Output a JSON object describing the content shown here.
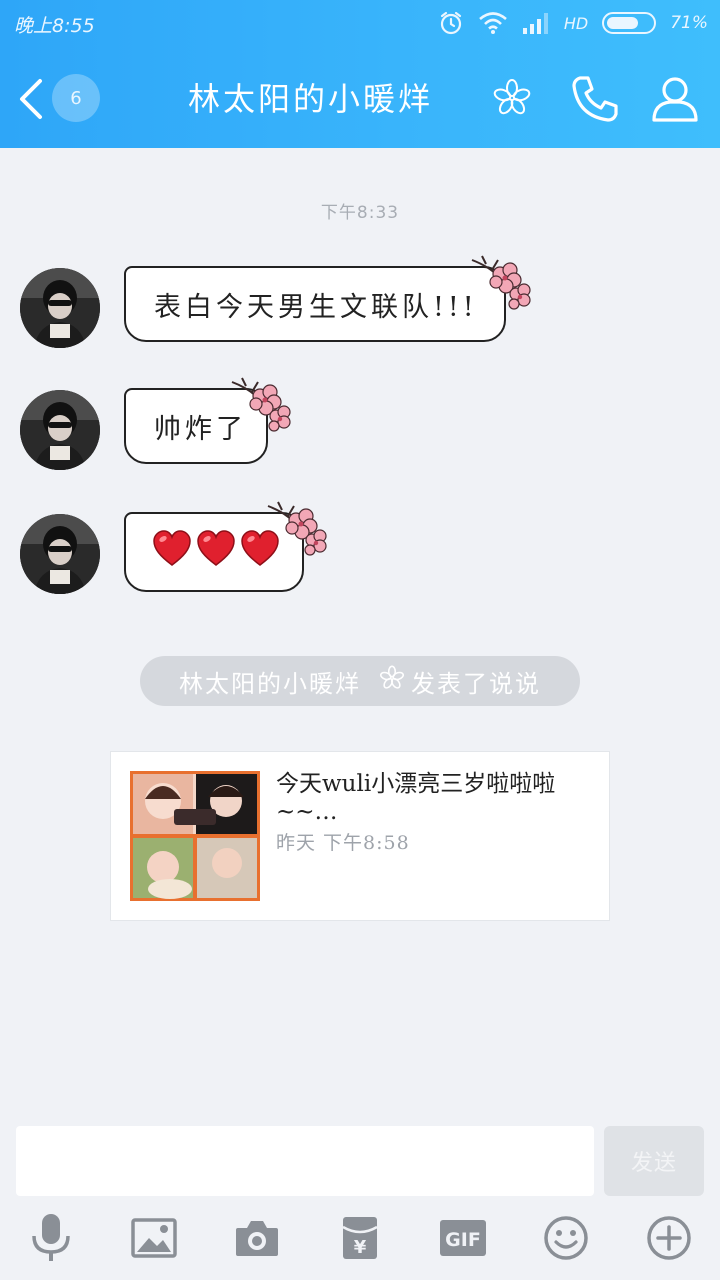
{
  "status_bar": {
    "time": "晚上8:55",
    "network": "HD",
    "battery_percent": 71,
    "battery_text": "71%"
  },
  "header": {
    "unread_count": "6",
    "title": "林太阳的小暖烊",
    "icons": [
      "back-arrow-icon",
      "flower-icon",
      "phone-icon",
      "user-icon"
    ]
  },
  "chat": {
    "timestamp": "下午8:33",
    "messages": [
      {
        "text": "表白今天男生文联队!!!"
      },
      {
        "text": "帅炸了"
      },
      {
        "text": "❤❤❤",
        "heart_count": 3
      }
    ],
    "system_notice": {
      "name": "林太阳的小暖烊",
      "action": "发表了说说"
    },
    "post_card": {
      "text": "今天wuli小漂亮三岁啦啦啦~~…",
      "time": "昨天 下午8:58"
    }
  },
  "input": {
    "value": "",
    "placeholder": "",
    "send_label": "发送"
  },
  "toolbar": {
    "icons": [
      "microphone-icon",
      "image-icon",
      "camera-icon",
      "red-packet-icon",
      "gif-icon",
      "emoji-icon",
      "plus-icon"
    ],
    "gif_label": "GIF",
    "red_packet_glyph": "¥"
  },
  "colors": {
    "header_gradient_start": "#2ea6f8",
    "header_gradient_end": "#3fbefc",
    "background": "#f0f2f6",
    "toolbar_icon": "#8a8f96"
  }
}
